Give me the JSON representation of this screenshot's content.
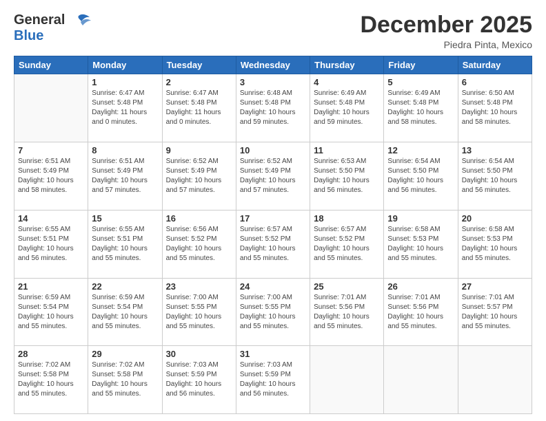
{
  "header": {
    "logo_general": "General",
    "logo_blue": "Blue",
    "title": "December 2025",
    "location": "Piedra Pinta, Mexico"
  },
  "calendar": {
    "days_of_week": [
      "Sunday",
      "Monday",
      "Tuesday",
      "Wednesday",
      "Thursday",
      "Friday",
      "Saturday"
    ],
    "weeks": [
      [
        {
          "day": "",
          "sunrise": "",
          "sunset": "",
          "daylight": ""
        },
        {
          "day": "1",
          "sunrise": "Sunrise: 6:47 AM",
          "sunset": "Sunset: 5:48 PM",
          "daylight": "Daylight: 11 hours and 0 minutes."
        },
        {
          "day": "2",
          "sunrise": "Sunrise: 6:47 AM",
          "sunset": "Sunset: 5:48 PM",
          "daylight": "Daylight: 11 hours and 0 minutes."
        },
        {
          "day": "3",
          "sunrise": "Sunrise: 6:48 AM",
          "sunset": "Sunset: 5:48 PM",
          "daylight": "Daylight: 10 hours and 59 minutes."
        },
        {
          "day": "4",
          "sunrise": "Sunrise: 6:49 AM",
          "sunset": "Sunset: 5:48 PM",
          "daylight": "Daylight: 10 hours and 59 minutes."
        },
        {
          "day": "5",
          "sunrise": "Sunrise: 6:49 AM",
          "sunset": "Sunset: 5:48 PM",
          "daylight": "Daylight: 10 hours and 58 minutes."
        },
        {
          "day": "6",
          "sunrise": "Sunrise: 6:50 AM",
          "sunset": "Sunset: 5:48 PM",
          "daylight": "Daylight: 10 hours and 58 minutes."
        }
      ],
      [
        {
          "day": "7",
          "sunrise": "Sunrise: 6:51 AM",
          "sunset": "Sunset: 5:49 PM",
          "daylight": "Daylight: 10 hours and 58 minutes."
        },
        {
          "day": "8",
          "sunrise": "Sunrise: 6:51 AM",
          "sunset": "Sunset: 5:49 PM",
          "daylight": "Daylight: 10 hours and 57 minutes."
        },
        {
          "day": "9",
          "sunrise": "Sunrise: 6:52 AM",
          "sunset": "Sunset: 5:49 PM",
          "daylight": "Daylight: 10 hours and 57 minutes."
        },
        {
          "day": "10",
          "sunrise": "Sunrise: 6:52 AM",
          "sunset": "Sunset: 5:49 PM",
          "daylight": "Daylight: 10 hours and 57 minutes."
        },
        {
          "day": "11",
          "sunrise": "Sunrise: 6:53 AM",
          "sunset": "Sunset: 5:50 PM",
          "daylight": "Daylight: 10 hours and 56 minutes."
        },
        {
          "day": "12",
          "sunrise": "Sunrise: 6:54 AM",
          "sunset": "Sunset: 5:50 PM",
          "daylight": "Daylight: 10 hours and 56 minutes."
        },
        {
          "day": "13",
          "sunrise": "Sunrise: 6:54 AM",
          "sunset": "Sunset: 5:50 PM",
          "daylight": "Daylight: 10 hours and 56 minutes."
        }
      ],
      [
        {
          "day": "14",
          "sunrise": "Sunrise: 6:55 AM",
          "sunset": "Sunset: 5:51 PM",
          "daylight": "Daylight: 10 hours and 56 minutes."
        },
        {
          "day": "15",
          "sunrise": "Sunrise: 6:55 AM",
          "sunset": "Sunset: 5:51 PM",
          "daylight": "Daylight: 10 hours and 55 minutes."
        },
        {
          "day": "16",
          "sunrise": "Sunrise: 6:56 AM",
          "sunset": "Sunset: 5:52 PM",
          "daylight": "Daylight: 10 hours and 55 minutes."
        },
        {
          "day": "17",
          "sunrise": "Sunrise: 6:57 AM",
          "sunset": "Sunset: 5:52 PM",
          "daylight": "Daylight: 10 hours and 55 minutes."
        },
        {
          "day": "18",
          "sunrise": "Sunrise: 6:57 AM",
          "sunset": "Sunset: 5:52 PM",
          "daylight": "Daylight: 10 hours and 55 minutes."
        },
        {
          "day": "19",
          "sunrise": "Sunrise: 6:58 AM",
          "sunset": "Sunset: 5:53 PM",
          "daylight": "Daylight: 10 hours and 55 minutes."
        },
        {
          "day": "20",
          "sunrise": "Sunrise: 6:58 AM",
          "sunset": "Sunset: 5:53 PM",
          "daylight": "Daylight: 10 hours and 55 minutes."
        }
      ],
      [
        {
          "day": "21",
          "sunrise": "Sunrise: 6:59 AM",
          "sunset": "Sunset: 5:54 PM",
          "daylight": "Daylight: 10 hours and 55 minutes."
        },
        {
          "day": "22",
          "sunrise": "Sunrise: 6:59 AM",
          "sunset": "Sunset: 5:54 PM",
          "daylight": "Daylight: 10 hours and 55 minutes."
        },
        {
          "day": "23",
          "sunrise": "Sunrise: 7:00 AM",
          "sunset": "Sunset: 5:55 PM",
          "daylight": "Daylight: 10 hours and 55 minutes."
        },
        {
          "day": "24",
          "sunrise": "Sunrise: 7:00 AM",
          "sunset": "Sunset: 5:55 PM",
          "daylight": "Daylight: 10 hours and 55 minutes."
        },
        {
          "day": "25",
          "sunrise": "Sunrise: 7:01 AM",
          "sunset": "Sunset: 5:56 PM",
          "daylight": "Daylight: 10 hours and 55 minutes."
        },
        {
          "day": "26",
          "sunrise": "Sunrise: 7:01 AM",
          "sunset": "Sunset: 5:56 PM",
          "daylight": "Daylight: 10 hours and 55 minutes."
        },
        {
          "day": "27",
          "sunrise": "Sunrise: 7:01 AM",
          "sunset": "Sunset: 5:57 PM",
          "daylight": "Daylight: 10 hours and 55 minutes."
        }
      ],
      [
        {
          "day": "28",
          "sunrise": "Sunrise: 7:02 AM",
          "sunset": "Sunset: 5:58 PM",
          "daylight": "Daylight: 10 hours and 55 minutes."
        },
        {
          "day": "29",
          "sunrise": "Sunrise: 7:02 AM",
          "sunset": "Sunset: 5:58 PM",
          "daylight": "Daylight: 10 hours and 55 minutes."
        },
        {
          "day": "30",
          "sunrise": "Sunrise: 7:03 AM",
          "sunset": "Sunset: 5:59 PM",
          "daylight": "Daylight: 10 hours and 56 minutes."
        },
        {
          "day": "31",
          "sunrise": "Sunrise: 7:03 AM",
          "sunset": "Sunset: 5:59 PM",
          "daylight": "Daylight: 10 hours and 56 minutes."
        },
        {
          "day": "",
          "sunrise": "",
          "sunset": "",
          "daylight": ""
        },
        {
          "day": "",
          "sunrise": "",
          "sunset": "",
          "daylight": ""
        },
        {
          "day": "",
          "sunrise": "",
          "sunset": "",
          "daylight": ""
        }
      ]
    ]
  }
}
